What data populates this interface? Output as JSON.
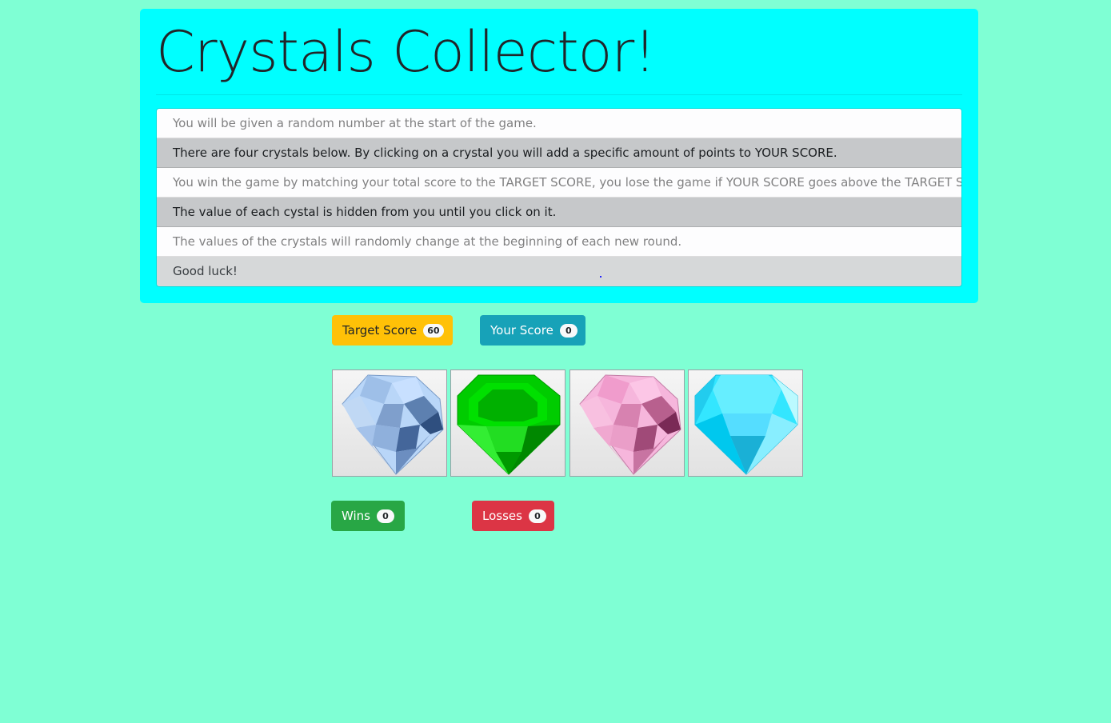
{
  "header": {
    "title": "Crystals Collector!"
  },
  "instructions": [
    "You will be given a random number at the start of the game.",
    "There are four crystals below. By clicking on a crystal you will add a specific amount of points to YOUR SCORE.",
    "You win the game by matching your total score to the TARGET SCORE, you lose the game if YOUR SCORE goes above the TARGET SCORE.",
    "The value of each cystal is hidden from you until you click on it.",
    "The values of the crystals will randomly change at the beginning of each new round.",
    "Good luck!"
  ],
  "scores": {
    "target_label": "Target Score",
    "target_value": "60",
    "your_label": "Your Score",
    "your_value": "0"
  },
  "record": {
    "wins_label": "Wins",
    "wins_value": "0",
    "losses_label": "Losses",
    "losses_value": "0"
  },
  "crystals": [
    {
      "name": "blue-crystal",
      "color": "#a9c8f0"
    },
    {
      "name": "green-crystal",
      "color": "#00cc00"
    },
    {
      "name": "pink-crystal",
      "color": "#f4a6d0"
    },
    {
      "name": "cyan-crystal",
      "color": "#33eeff"
    }
  ],
  "colors": {
    "background": "#7fffd4",
    "jumbotron": "#00ffff",
    "target": "#ffc107",
    "your": "#17a2b8",
    "wins": "#28a745",
    "losses": "#dc3545"
  }
}
